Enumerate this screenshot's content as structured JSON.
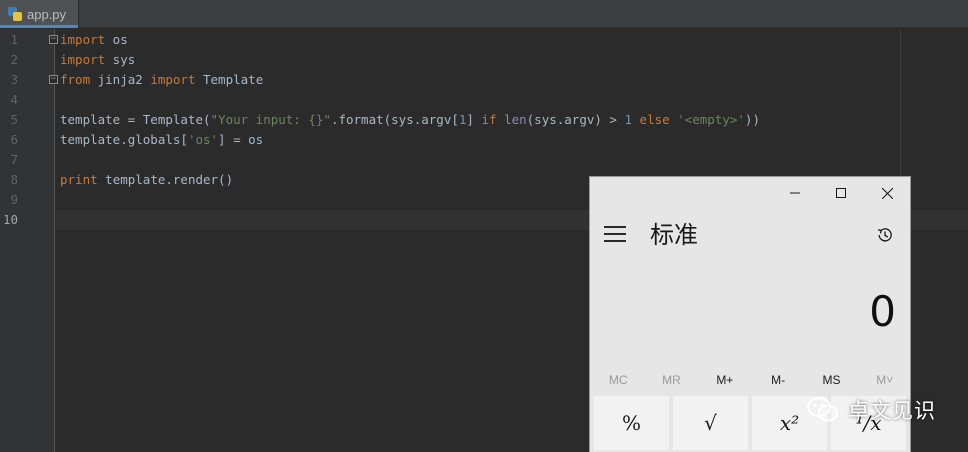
{
  "ide": {
    "tab": {
      "label": "app.py"
    },
    "lines": [
      {
        "number": "1",
        "code": "import os"
      },
      {
        "number": "2",
        "code": "import sys"
      },
      {
        "number": "3",
        "code": "from jinja2 import Template"
      },
      {
        "number": "4",
        "code": ""
      },
      {
        "number": "5",
        "code": "template = Template(\"Your input: {}\".format(sys.argv[1] if len(sys.argv) > 1 else '<empty>'))"
      },
      {
        "number": "6",
        "code": "template.globals['os'] = os"
      },
      {
        "number": "7",
        "code": ""
      },
      {
        "number": "8",
        "code": "print template.render()"
      },
      {
        "number": "9",
        "code": ""
      },
      {
        "number": "10",
        "code": ""
      }
    ],
    "current_line": "10",
    "colors": {
      "keyword": "#cc7832",
      "string": "#6a8759",
      "number": "#6897bb",
      "builtin": "#8888c6",
      "text": "#a9b7c6"
    }
  },
  "calculator": {
    "mode_title": "标准",
    "display_value": "0",
    "window_controls": {
      "minimize": "minimize-icon",
      "maximize": "maximize-icon",
      "close": "close-icon"
    },
    "memory": [
      {
        "label": "MC",
        "enabled": false
      },
      {
        "label": "MR",
        "enabled": false
      },
      {
        "label": "M+",
        "enabled": true
      },
      {
        "label": "M-",
        "enabled": true
      },
      {
        "label": "MS",
        "enabled": true
      },
      {
        "label": "M˅",
        "enabled": false
      }
    ],
    "keys": [
      "%",
      "√",
      "x²",
      "¹/x"
    ]
  },
  "watermark": {
    "text": "卓文见识"
  }
}
